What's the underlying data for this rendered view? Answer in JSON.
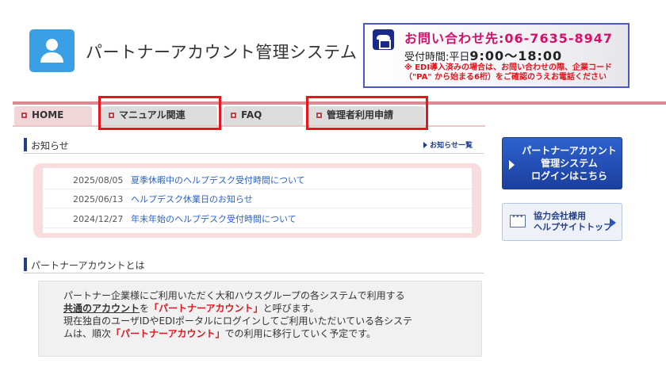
{
  "header": {
    "title": "パートナーアカウント管理システム",
    "contact_line1": "お問い合わせ先:06-7635-8947",
    "contact_hours_label": "受付時間:平日",
    "contact_hours_value": "9:00～18:00",
    "contact_note_1": "※ EDI導入済みの場合は、お問い合わせの際、企業コード",
    "contact_note_2": "（\"PA\" から始まる6桁）をご確認のうえお電話ください"
  },
  "nav": {
    "tabs": [
      {
        "label": "HOME"
      },
      {
        "label": "マニュアル関連"
      },
      {
        "label": "FAQ"
      },
      {
        "label": "管理者利用申請"
      }
    ]
  },
  "news": {
    "heading": "お知らせ",
    "all_link": "お知らせ一覧",
    "items": [
      {
        "date": "2025/08/05",
        "title": "夏季休暇中のヘルプデスク受付時間について"
      },
      {
        "date": "2025/06/13",
        "title": "ヘルプデスク休業日のお知らせ"
      },
      {
        "date": "2024/12/27",
        "title": "年末年始のヘルプデスク受付時間について"
      }
    ]
  },
  "about": {
    "heading": "パートナーアカウントとは",
    "line1": "パートナー企業様にご利用いただく大和ハウスグループの各システムで利用する",
    "line2_a": "共通のアカウント",
    "line2_b": "を",
    "line2_c": "「パートナーアカウント」",
    "line2_d": "と呼びます。",
    "line3": "現在独自のユーザIDやEDIポータルにログインしてご利用いただいている各システ",
    "line4_a": "ムは、順次",
    "line4_b": "「パートナーアカウント」",
    "line4_c": "での利用に移行していく予定です。"
  },
  "sidebar": {
    "login_line1": "パートナーアカウント",
    "login_line2": "管理システム",
    "login_line3": "ログインはこちら",
    "help_line1": "協力会社様用",
    "help_line2": "ヘルプサイトトップ"
  },
  "colors": {
    "brand_blue": "#233f8c",
    "accent_pink": "#d98a92",
    "highlight_red": "#e8141e"
  }
}
